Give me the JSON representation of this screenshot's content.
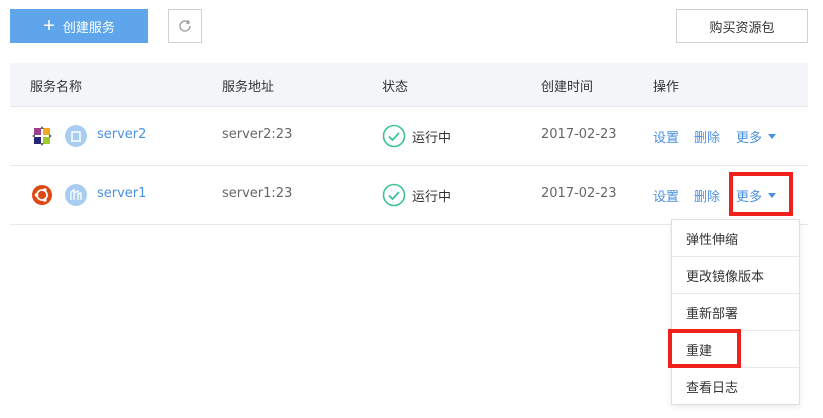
{
  "toolbar": {
    "create_label": "创建服务",
    "create_icon": "plus-icon",
    "refresh_icon": "refresh-icon",
    "buy_label": "购买资源包"
  },
  "table": {
    "headers": {
      "name": "服务名称",
      "address": "服务地址",
      "status": "状态",
      "created": "创建时间",
      "actions": "操作"
    },
    "rows": [
      {
        "os_icon": "centos-icon",
        "service_icon": "server-icon",
        "name": "server2",
        "address": "server2:23",
        "status_icon": "check-circle-icon",
        "status": "运行中",
        "created": "2017-02-23",
        "action_set": "设置",
        "action_delete": "删除",
        "action_more": "更多"
      },
      {
        "os_icon": "ubuntu-icon",
        "service_icon": "server-icon",
        "name": "server1",
        "address": "server1:23",
        "status_icon": "check-circle-icon",
        "status": "运行中",
        "created": "2017-02-23",
        "action_set": "设置",
        "action_delete": "删除",
        "action_more": "更多"
      }
    ]
  },
  "more_menu": {
    "items": [
      "弹性伸缩",
      "更改镜像版本",
      "重新部署",
      "重建",
      "查看日志"
    ]
  },
  "colors": {
    "primary": "#5fa5ec",
    "link": "#4a90e2",
    "status_ok": "#3cc29a",
    "highlight": "#f0201b",
    "header_bg": "#f3f5f8"
  }
}
